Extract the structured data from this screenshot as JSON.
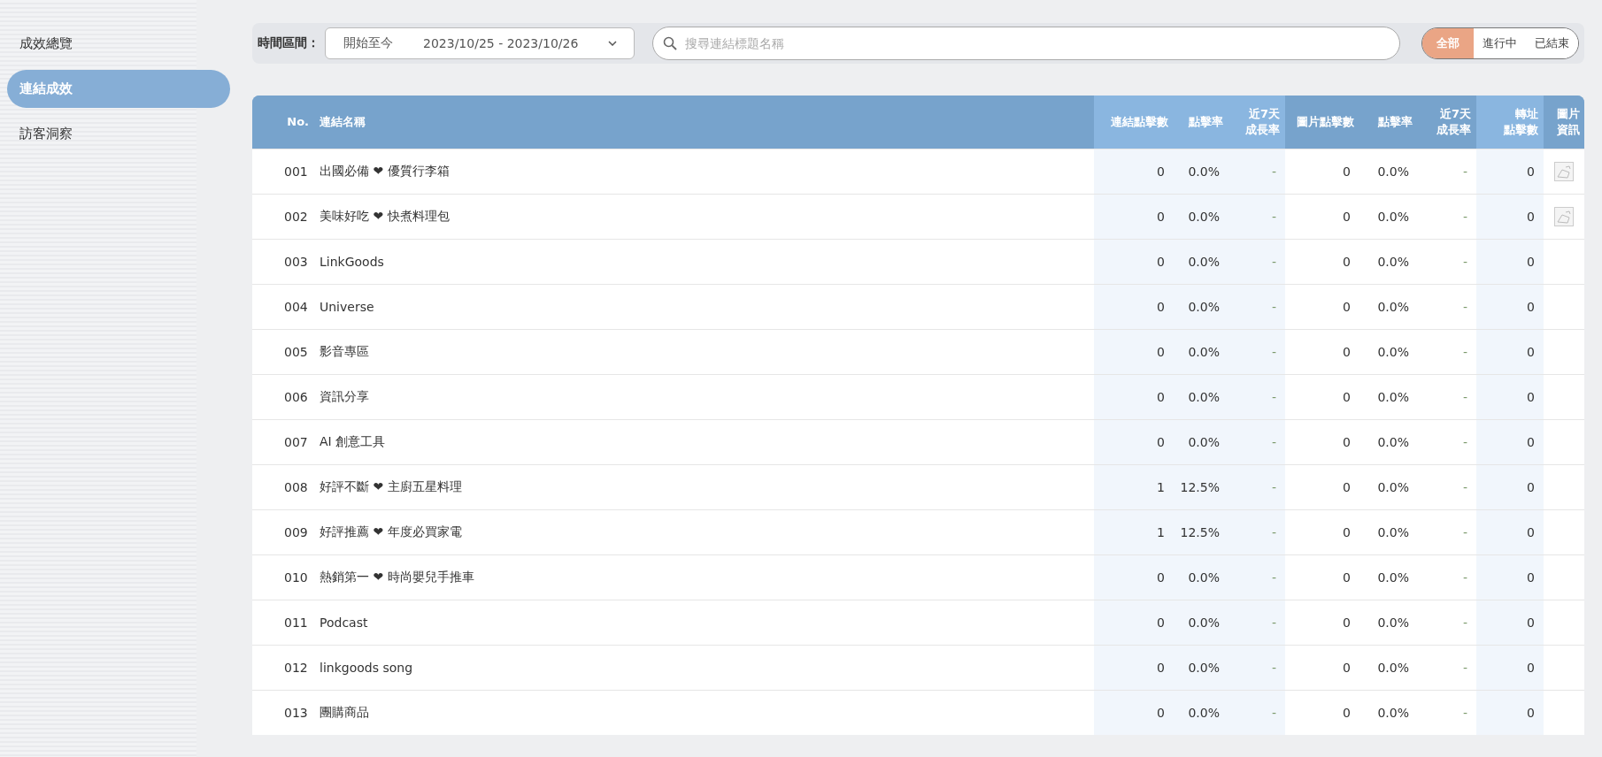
{
  "sidebar": {
    "items": [
      {
        "label": "成效總覽",
        "selected": false
      },
      {
        "label": "連結成效",
        "selected": true
      },
      {
        "label": "訪客洞察",
        "selected": false
      }
    ]
  },
  "filter_bar": {
    "date_label": "時間區間：",
    "date_range": {
      "preset": "開始至今",
      "value": "2023/10/25 - 2023/10/26"
    },
    "search": {
      "placeholder": "搜尋連結標題名稱"
    },
    "status_tabs": [
      {
        "label": "全部",
        "selected": true
      },
      {
        "label": "進行中",
        "selected": false
      },
      {
        "label": "已結束",
        "selected": false
      }
    ]
  },
  "table": {
    "columns": [
      {
        "lines": [
          "No."
        ],
        "kind": "base"
      },
      {
        "lines": [
          "連結名稱"
        ],
        "kind": "base"
      },
      {
        "lines": [
          "連結點擊數"
        ],
        "kind": "link"
      },
      {
        "lines": [
          "點擊率"
        ],
        "kind": "link"
      },
      {
        "lines": [
          "近7天",
          "成長率"
        ],
        "kind": "link"
      },
      {
        "lines": [
          "圖片點擊數"
        ],
        "kind": "image"
      },
      {
        "lines": [
          "點擊率"
        ],
        "kind": "image"
      },
      {
        "lines": [
          "近7天",
          "成長率"
        ],
        "kind": "image"
      },
      {
        "lines": [
          "轉址",
          "點擊數"
        ],
        "kind": "redirect"
      },
      {
        "lines": [
          "圖片",
          "資訊"
        ],
        "kind": "info"
      }
    ],
    "rows": [
      {
        "no": "001",
        "name": "出國必備 ❤ 優質行李箱",
        "values": [
          "0",
          "0.0%",
          "-",
          "0",
          "0.0%",
          "-",
          "0"
        ],
        "has_image": true
      },
      {
        "no": "002",
        "name": "美味好吃 ❤ 快煮料理包",
        "values": [
          "0",
          "0.0%",
          "-",
          "0",
          "0.0%",
          "-",
          "0"
        ],
        "has_image": true
      },
      {
        "no": "003",
        "name": "LinkGoods",
        "values": [
          "0",
          "0.0%",
          "-",
          "0",
          "0.0%",
          "-",
          "0"
        ],
        "has_image": false
      },
      {
        "no": "004",
        "name": "Universe",
        "values": [
          "0",
          "0.0%",
          "-",
          "0",
          "0.0%",
          "-",
          "0"
        ],
        "has_image": false
      },
      {
        "no": "005",
        "name": "影音專區",
        "values": [
          "0",
          "0.0%",
          "-",
          "0",
          "0.0%",
          "-",
          "0"
        ],
        "has_image": false
      },
      {
        "no": "006",
        "name": "資訊分享",
        "values": [
          "0",
          "0.0%",
          "-",
          "0",
          "0.0%",
          "-",
          "0"
        ],
        "has_image": false
      },
      {
        "no": "007",
        "name": "AI 創意工具",
        "values": [
          "0",
          "0.0%",
          "-",
          "0",
          "0.0%",
          "-",
          "0"
        ],
        "has_image": false
      },
      {
        "no": "008",
        "name": "好評不斷 ❤ 主廚五星料理",
        "values": [
          "1",
          "12.5%",
          "-",
          "0",
          "0.0%",
          "-",
          "0"
        ],
        "has_image": false
      },
      {
        "no": "009",
        "name": "好評推薦 ❤ 年度必買家電",
        "values": [
          "1",
          "12.5%",
          "-",
          "0",
          "0.0%",
          "-",
          "0"
        ],
        "has_image": false
      },
      {
        "no": "010",
        "name": "熱銷第一 ❤ 時尚嬰兒手推車",
        "values": [
          "0",
          "0.0%",
          "-",
          "0",
          "0.0%",
          "-",
          "0"
        ],
        "has_image": false
      },
      {
        "no": "011",
        "name": "Podcast",
        "values": [
          "0",
          "0.0%",
          "-",
          "0",
          "0.0%",
          "-",
          "0"
        ],
        "has_image": false
      },
      {
        "no": "012",
        "name": "linkgoods song",
        "values": [
          "0",
          "0.0%",
          "-",
          "0",
          "0.0%",
          "-",
          "0"
        ],
        "has_image": false
      },
      {
        "no": "013",
        "name": "團購商品",
        "values": [
          "0",
          "0.0%",
          "-",
          "0",
          "0.0%",
          "-",
          "0"
        ],
        "has_image": false
      }
    ]
  }
}
